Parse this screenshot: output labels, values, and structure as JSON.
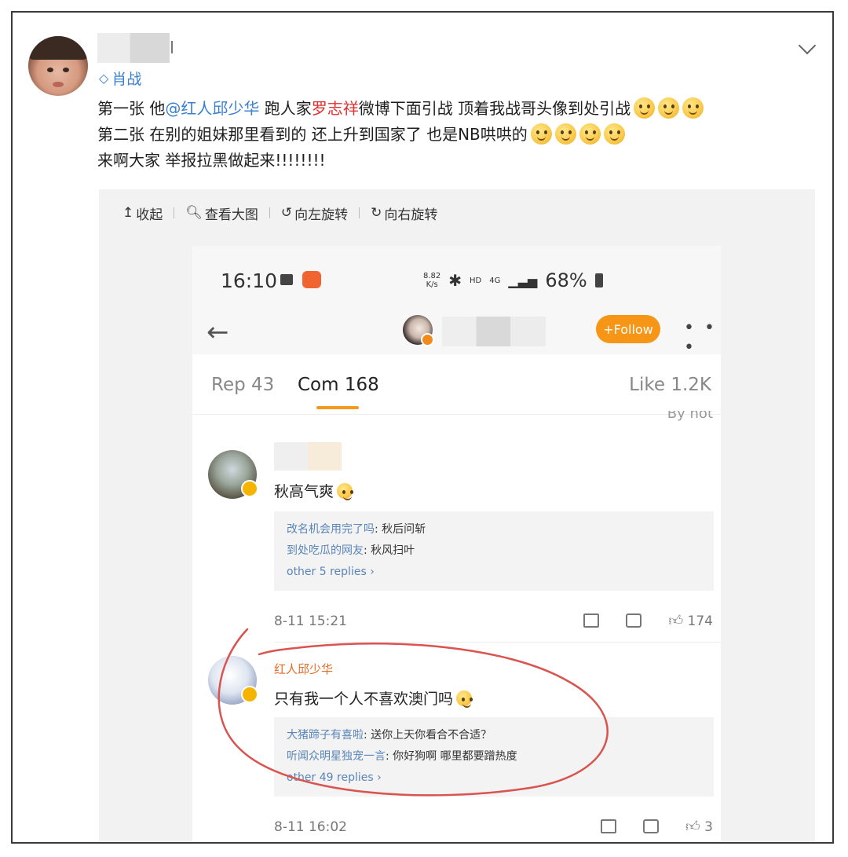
{
  "post": {
    "tagline": "肖战",
    "lines": [
      {
        "pre": "第一张 他",
        "mention": "@红人邱少华",
        "mid": " 跑人家",
        "hot": "罗志祥",
        "post": "微博下面引战 顶着我战哥头像到处引战"
      },
      {
        "pre": "第二张 在别的姐妹那里看到的 还上升到国家了 也是NB哄哄的"
      },
      {
        "pre": "来啊大家 举报拉黑做起来!!!!!!!!"
      }
    ]
  },
  "toolbar": {
    "collapse": "收起",
    "view_large": "查看大图",
    "rotate_left": "向左旋转",
    "rotate_right": "向右旋转"
  },
  "screenshot": {
    "status": {
      "time": "16:10",
      "speed_top": "8.82",
      "speed_bottom": "K/s",
      "hd": "HD",
      "net": "4G",
      "battery": "68%"
    },
    "nav": {
      "follow": "+Follow",
      "more": "• • •"
    },
    "tabs": {
      "reposts": "Rep 43",
      "comments": "Com 168",
      "likes": "Like 1.2K",
      "sort": "By hot"
    },
    "comments": [
      {
        "text": "秋高气爽",
        "replies": [
          {
            "user": "改名机会用完了吗",
            "text": ": 秋后问斩"
          },
          {
            "user": "到处吃瓜的网友",
            "text": ": 秋风扫叶"
          }
        ],
        "more": "other 5 replies",
        "time": "8-11 15:21",
        "likes": "174"
      },
      {
        "name": "红人邱少华",
        "text": "只有我一个人不喜欢澳门吗",
        "replies": [
          {
            "user": "大猪蹄子有喜啦",
            "text": ": 送你上天你看合不合适？"
          },
          {
            "user": "听闻众明星独宠一言",
            "text": ": 你好狗啊 哪里都要蹭热度"
          }
        ],
        "more": "other 49 replies",
        "time": "8-11 16:02",
        "likes": "3"
      }
    ]
  },
  "colors": {
    "link": "#3a7fd0",
    "hot": "#e0302f",
    "follow": "#f79516",
    "accent_underline": "#f39a1e",
    "annotation": "#d9534f"
  },
  "icons": [
    "verified-diamond-icon",
    "chevron-down-icon",
    "upload-icon",
    "search-icon",
    "rotate-left-icon",
    "rotate-right-icon",
    "back-arrow-icon",
    "share-icon",
    "comment-icon",
    "like-icon"
  ]
}
